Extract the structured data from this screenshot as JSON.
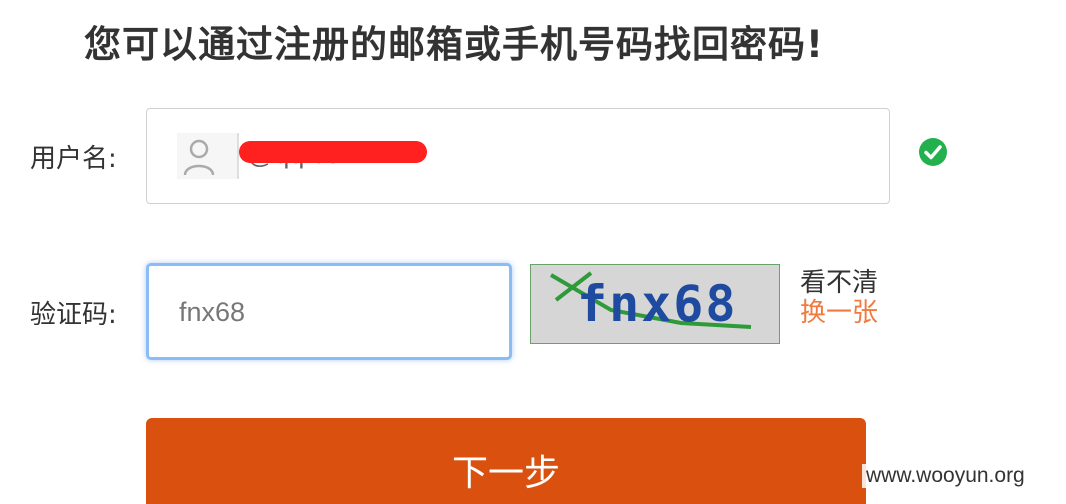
{
  "title": "您可以通过注册的邮箱或手机号码找回密码!",
  "username": {
    "label": "用户名:",
    "value": "@qq.com",
    "icon": "user-icon",
    "status_icon": "check-circle-icon",
    "status_color": "#22b14c"
  },
  "captcha": {
    "label": "验证码:",
    "value": "fnx68",
    "image_text": "fnx68",
    "refresh_line1": "看不清",
    "refresh_line2": "换一张"
  },
  "next_button": {
    "label": "下一步",
    "color": "#d9500f"
  },
  "watermark": "www.wooyun.org"
}
